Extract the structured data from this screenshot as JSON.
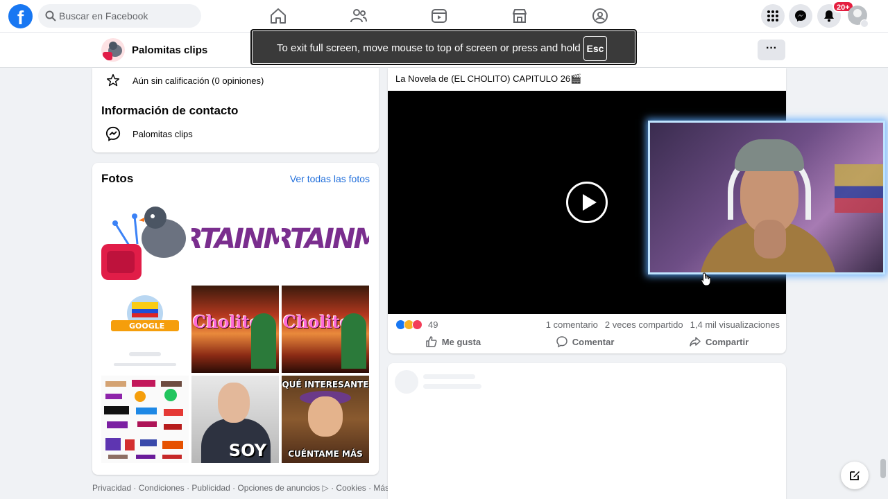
{
  "topbar": {
    "search_placeholder": "Buscar en Facebook",
    "notifications_badge": "20+"
  },
  "subbar": {
    "page_name": "Palomitas clips"
  },
  "fullscreen_toast": {
    "message": "To exit full screen, move mouse to top of screen or press and hold",
    "key": "Esc"
  },
  "info": {
    "rating": "Aún sin calificación (0 opiniones)",
    "contact_title": "Información de contacto",
    "contact_item": "Palomitas clips"
  },
  "photos": {
    "title": "Fotos",
    "see_all": "Ver todas las fotos",
    "items": [
      {
        "text": ""
      },
      {
        "text": "RTAINM"
      },
      {
        "text": "RTAINM"
      },
      {
        "text": "GOOGLE"
      },
      {
        "text": "Cholito"
      },
      {
        "text": "Cholito"
      },
      {
        "text": ""
      },
      {
        "text": "SOY"
      },
      {
        "top": "QUÉ INTERESANTE",
        "bottom": "CUÉNTAME MÁS"
      }
    ]
  },
  "footer": {
    "links": "Privacidad · Condiciones · Publicidad · Opciones de anuncios ▷ · Cookies · Más"
  },
  "post": {
    "text": "La Novela de (EL CHOLITO) CAPITULO 26🎬",
    "reaction_count": "49",
    "comments": "1 comentario",
    "shares": "2 veces compartido",
    "views": "1,4 mil visualizaciones",
    "like_label": "Me gusta",
    "comment_label": "Comentar",
    "share_label": "Compartir"
  },
  "colors": {
    "brand": "#1877f2",
    "link": "#216fdb",
    "badge": "#e41e3f"
  }
}
